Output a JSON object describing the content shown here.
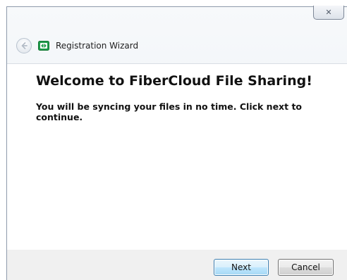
{
  "window": {
    "title": "Registration Wizard",
    "close_label": "✕"
  },
  "page": {
    "heading": "Welcome to FiberCloud File Sharing!",
    "description": "You will be syncing your files in no time.  Click next to continue."
  },
  "buttons": {
    "next": "Next",
    "cancel": "Cancel"
  },
  "icons": {
    "back": "back-arrow-icon",
    "app": "fibercloud-app-icon",
    "close": "close-icon"
  },
  "colors": {
    "app_icon": "#1f9a4a",
    "next_border": "#3c7fb1"
  }
}
